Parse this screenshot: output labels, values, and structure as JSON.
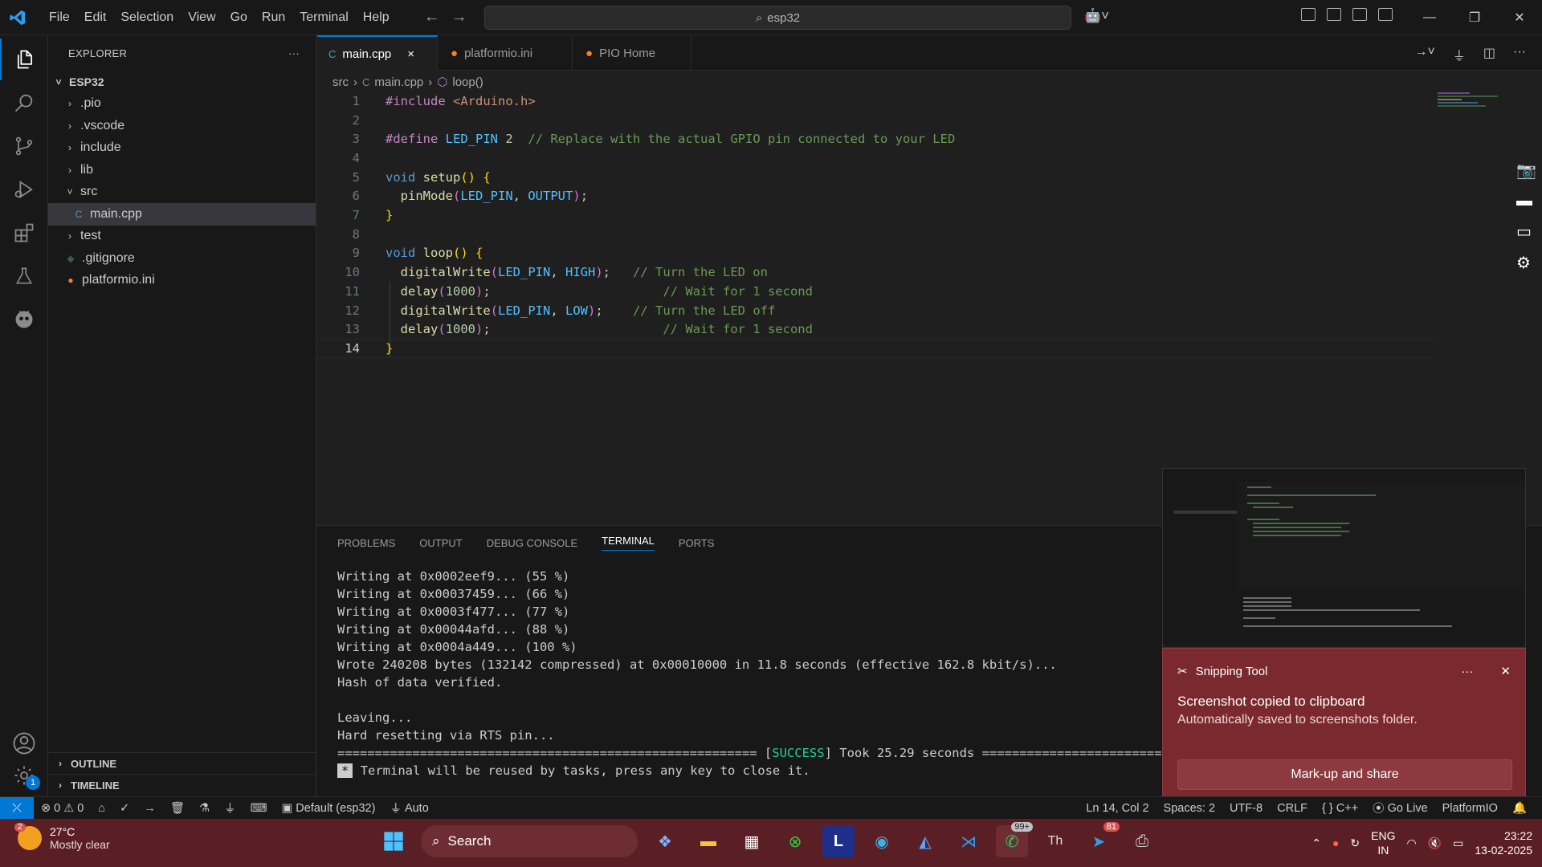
{
  "titlebar": {
    "menu": [
      "File",
      "Edit",
      "Selection",
      "View",
      "Go",
      "Run",
      "Terminal",
      "Help"
    ],
    "search": "esp32",
    "window_controls": [
      "minimize-icon",
      "restore-icon",
      "close-icon"
    ]
  },
  "activitybar": {
    "items": [
      "explorer-icon",
      "search-icon",
      "source-control-icon",
      "run-debug-icon",
      "extensions-icon",
      "testing-icon",
      "platformio-icon"
    ],
    "bottom": [
      "accounts-icon",
      "manage-gear-icon"
    ],
    "manage_badge": "1"
  },
  "sidebar": {
    "title": "EXPLORER",
    "more": "···",
    "root": "ESP32",
    "items": [
      {
        "label": ".pio",
        "type": "folder",
        "open": false
      },
      {
        "label": ".vscode",
        "type": "folder",
        "open": false
      },
      {
        "label": "include",
        "type": "folder",
        "open": false
      },
      {
        "label": "lib",
        "type": "folder",
        "open": false
      },
      {
        "label": "src",
        "type": "folder",
        "open": true
      },
      {
        "label": "main.cpp",
        "type": "file",
        "selected": true
      },
      {
        "label": "test",
        "type": "folder",
        "open": false
      },
      {
        "label": ".gitignore",
        "type": "file"
      },
      {
        "label": "platformio.ini",
        "type": "file"
      }
    ],
    "outline": "OUTLINE",
    "timeline": "TIMELINE"
  },
  "tabs": [
    {
      "label": "main.cpp",
      "active": true,
      "close": "×"
    },
    {
      "label": "platformio.ini",
      "active": false
    },
    {
      "label": "PIO Home",
      "active": false
    }
  ],
  "breadcrumb": {
    "folder": "src",
    "file": "main.cpp",
    "symbol": "loop()"
  },
  "editor": {
    "lines": [
      "1",
      "2",
      "3",
      "4",
      "5",
      "6",
      "7",
      "8",
      "9",
      "10",
      "11",
      "12",
      "13",
      "14"
    ],
    "code": {
      "l1_directive": "#include",
      "l1_header": "<Arduino.h>",
      "l3_directive": "#define",
      "l3_macro": "LED_PIN",
      "l3_value": "2",
      "l3_comment": "// Replace with the actual GPIO pin connected to your LED",
      "l5_type": "void",
      "l5_fn": "setup",
      "l6_fn": "pinMode",
      "l6_arg1": "LED_PIN",
      "l6_arg2": "OUTPUT",
      "l9_type": "void",
      "l9_fn": "loop",
      "l10_fn": "digitalWrite",
      "l10_arg1": "LED_PIN",
      "l10_arg2": "HIGH",
      "l10_comment": "// Turn the LED on",
      "l11_fn": "delay",
      "l11_num": "1000",
      "l11_comment": "// Wait for 1 second",
      "l12_fn": "digitalWrite",
      "l12_arg1": "LED_PIN",
      "l12_arg2": "LOW",
      "l12_comment": "// Turn the LED off",
      "l13_fn": "delay",
      "l13_num": "1000",
      "l13_comment": "// Wait for 1 second"
    },
    "current_line": "14"
  },
  "panel": {
    "tabs": [
      "PROBLEMS",
      "OUTPUT",
      "DEBUG CONSOLE",
      "TERMINAL",
      "PORTS"
    ],
    "active_tab": "TERMINAL",
    "terminal": [
      "Writing at 0x0002eef9... (55 %)",
      "Writing at 0x00037459... (66 %)",
      "Writing at 0x0003f477... (77 %)",
      "Writing at 0x00044afd... (88 %)",
      "Writing at 0x0004a449... (100 %)",
      "Wrote 240208 bytes (132142 compressed) at 0x00010000 in 11.8 seconds (effective 162.8 kbit/s)...",
      "Hash of data verified.",
      "",
      "Leaving...",
      "Hard resetting via RTS pin..."
    ],
    "success_prefix": "========================================================",
    "success_word": "SUCCESS",
    "success_suffix": "Took 25.29 seconds ==================================",
    "reuse_marker": "*",
    "reuse": "Terminal will be reused by tasks, press any key to close it."
  },
  "toast": {
    "app": "Snipping Tool",
    "more": "···",
    "close": "✕",
    "title": "Screenshot copied to clipboard",
    "body": "Automatically saved to screenshots folder.",
    "button": "Mark-up and share"
  },
  "statusbar": {
    "errors": "0",
    "warnings": "0",
    "env": "Default (esp32)",
    "auto": "Auto",
    "position": "Ln 14, Col 2",
    "spaces": "Spaces: 2",
    "encoding": "UTF-8",
    "eol": "CRLF",
    "language": "C++",
    "golive": "Go Live",
    "platformio": "PlatformIO"
  },
  "taskbar": {
    "weather_temp": "27°C",
    "weather_desc": "Mostly clear",
    "weather_badge": "2",
    "search": "Search",
    "whatsapp_badge": "99+",
    "telegram_badge": "81",
    "lang1": "ENG",
    "lang2": "IN",
    "time": "23:22",
    "date": "13-02-2025"
  },
  "colors": {
    "accent": "#0078d4",
    "success": "#23d18b",
    "toast": "#7a2a2f",
    "taskbar": "#5a1f25"
  }
}
